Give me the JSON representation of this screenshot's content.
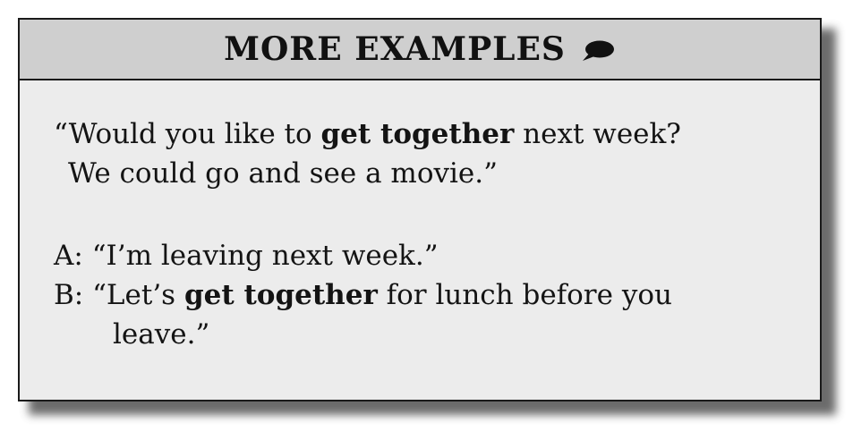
{
  "header": {
    "title": "MORE EXAMPLES"
  },
  "example1": {
    "line1_pre": "“Would you like to ",
    "line1_bold": "get together",
    "line1_post": " next week?",
    "line2": "We could go and see a movie.”"
  },
  "dialogue": {
    "a_speaker": "A:",
    "a_text": " “I’m leaving next week.”",
    "b_speaker": "B:",
    "b_pre": " “Let’s ",
    "b_bold": "get together",
    "b_post": " for lunch before you",
    "b_line2": "leave.”"
  }
}
